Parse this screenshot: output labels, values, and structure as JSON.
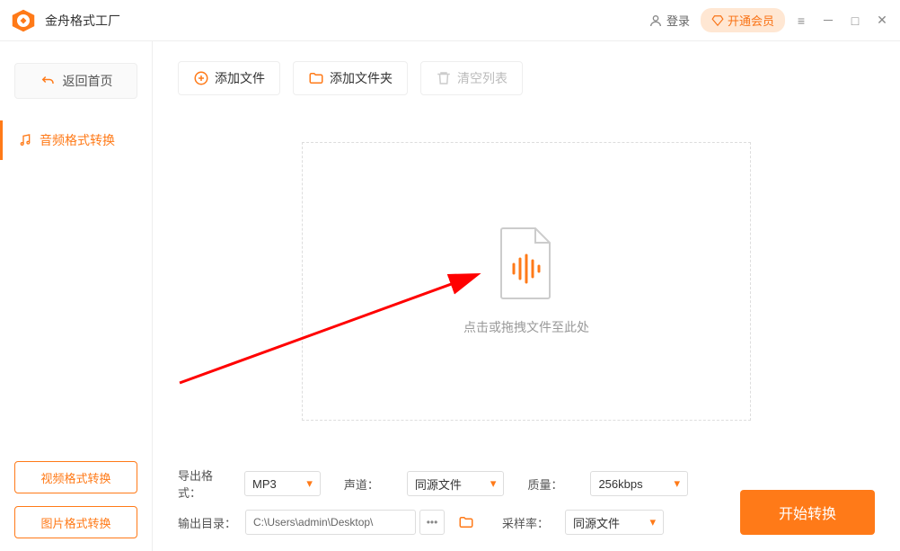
{
  "app": {
    "title": "金舟格式工厂"
  },
  "header": {
    "login": "登录",
    "vip": "开通会员"
  },
  "sidebar": {
    "back": "返回首页",
    "active_tab": "音频格式转换",
    "video_tab": "视频格式转换",
    "image_tab": "图片格式转换"
  },
  "toolbar": {
    "add_file": "添加文件",
    "add_folder": "添加文件夹",
    "clear_list": "清空列表"
  },
  "dropzone": {
    "text": "点击或拖拽文件至此处"
  },
  "controls": {
    "format_label": "导出格式：",
    "format_value": "MP3",
    "channel_label": "声道：",
    "channel_value": "同源文件",
    "quality_label": "质量：",
    "quality_value": "256kbps",
    "output_label": "输出目录：",
    "output_path": "C:\\Users\\admin\\Desktop\\",
    "sample_label": "采样率：",
    "sample_value": "同源文件"
  },
  "action": {
    "start": "开始转换"
  }
}
